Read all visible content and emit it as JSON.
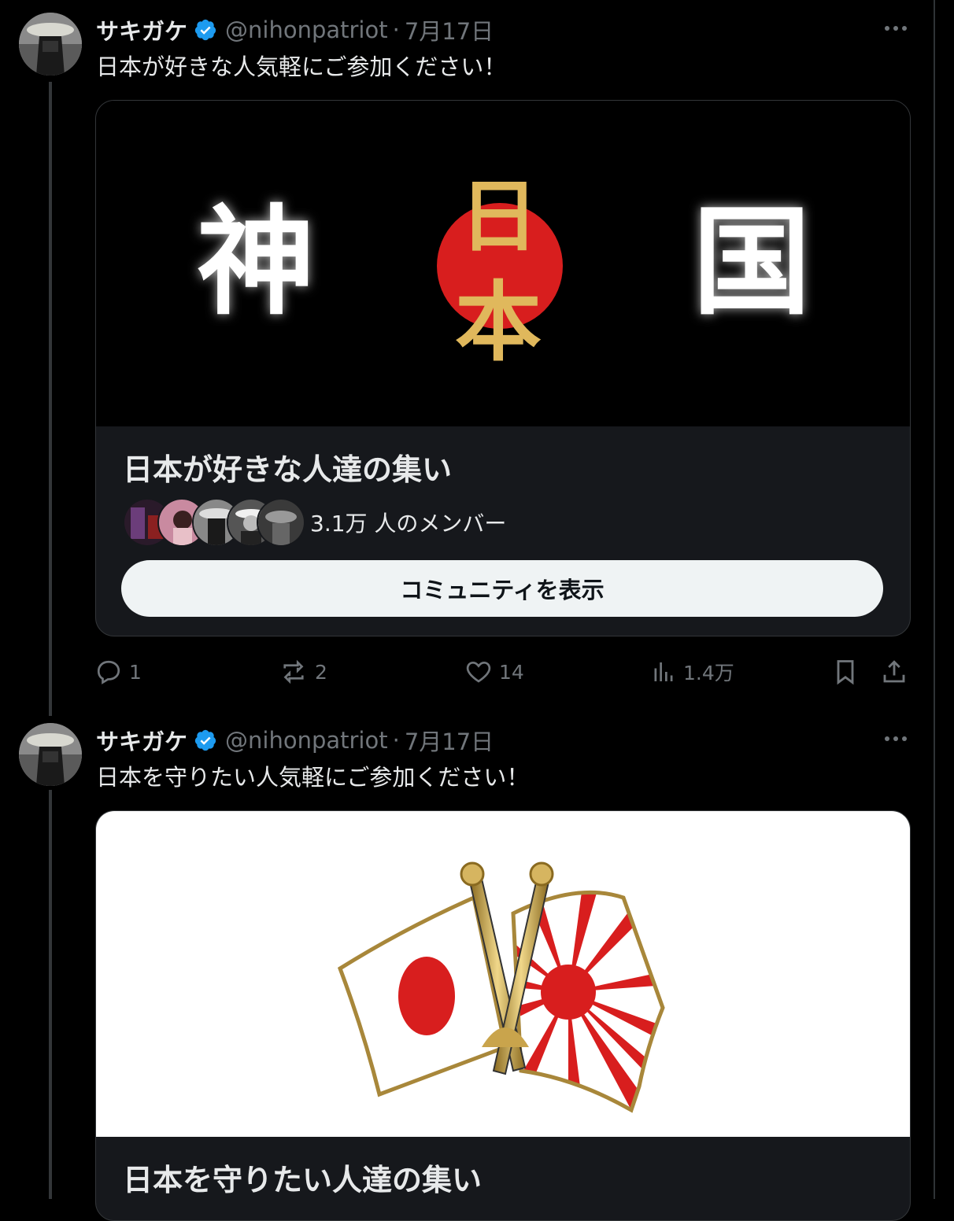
{
  "tweets": [
    {
      "author": {
        "name": "サキガケ",
        "handle": "@nihonpatriot",
        "separator": "·",
        "date": "7月17日"
      },
      "text": "日本が好きな人気軽にご参加ください！",
      "community": {
        "banner_chars": {
          "left": "神",
          "center_top": "日",
          "center_bottom": "本",
          "right": "国"
        },
        "title": "日本が好きな人達の集い",
        "member_count": "3.1万 人のメンバー",
        "button": "コミュニティを表示"
      },
      "stats": {
        "replies": "1",
        "reposts": "2",
        "likes": "14",
        "views": "1.4万"
      }
    },
    {
      "author": {
        "name": "サキガケ",
        "handle": "@nihonpatriot",
        "separator": "·",
        "date": "7月17日"
      },
      "text": "日本を守りたい人気軽にご参加ください！",
      "community": {
        "title": "日本を守りたい人達の集い"
      }
    }
  ],
  "colors": {
    "verified": "#1d9bf0",
    "hinomaru": "#d81e1e",
    "gold": "#d9b35a",
    "button_bg": "#eff3f4"
  },
  "icons": [
    "verified-badge-icon",
    "more-icon",
    "reply-icon",
    "repost-icon",
    "like-icon",
    "views-icon",
    "bookmark-icon",
    "share-icon"
  ]
}
